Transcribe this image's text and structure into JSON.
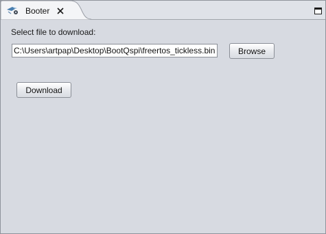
{
  "tab": {
    "title": "Booter",
    "icon": "booter-app-icon",
    "close_icon": "close-icon"
  },
  "view": {
    "maximize_icon": "maximize-icon"
  },
  "form": {
    "file_label": "Select file to download:",
    "file_path": "C:\\Users\\artpap\\Desktop\\BootQspi\\freertos_tickless.bin",
    "browse_label": "Browse",
    "download_label": "Download"
  },
  "colors": {
    "background": "#d7dae1",
    "tab_background": "#f4f5f7",
    "border": "#8f939b"
  }
}
